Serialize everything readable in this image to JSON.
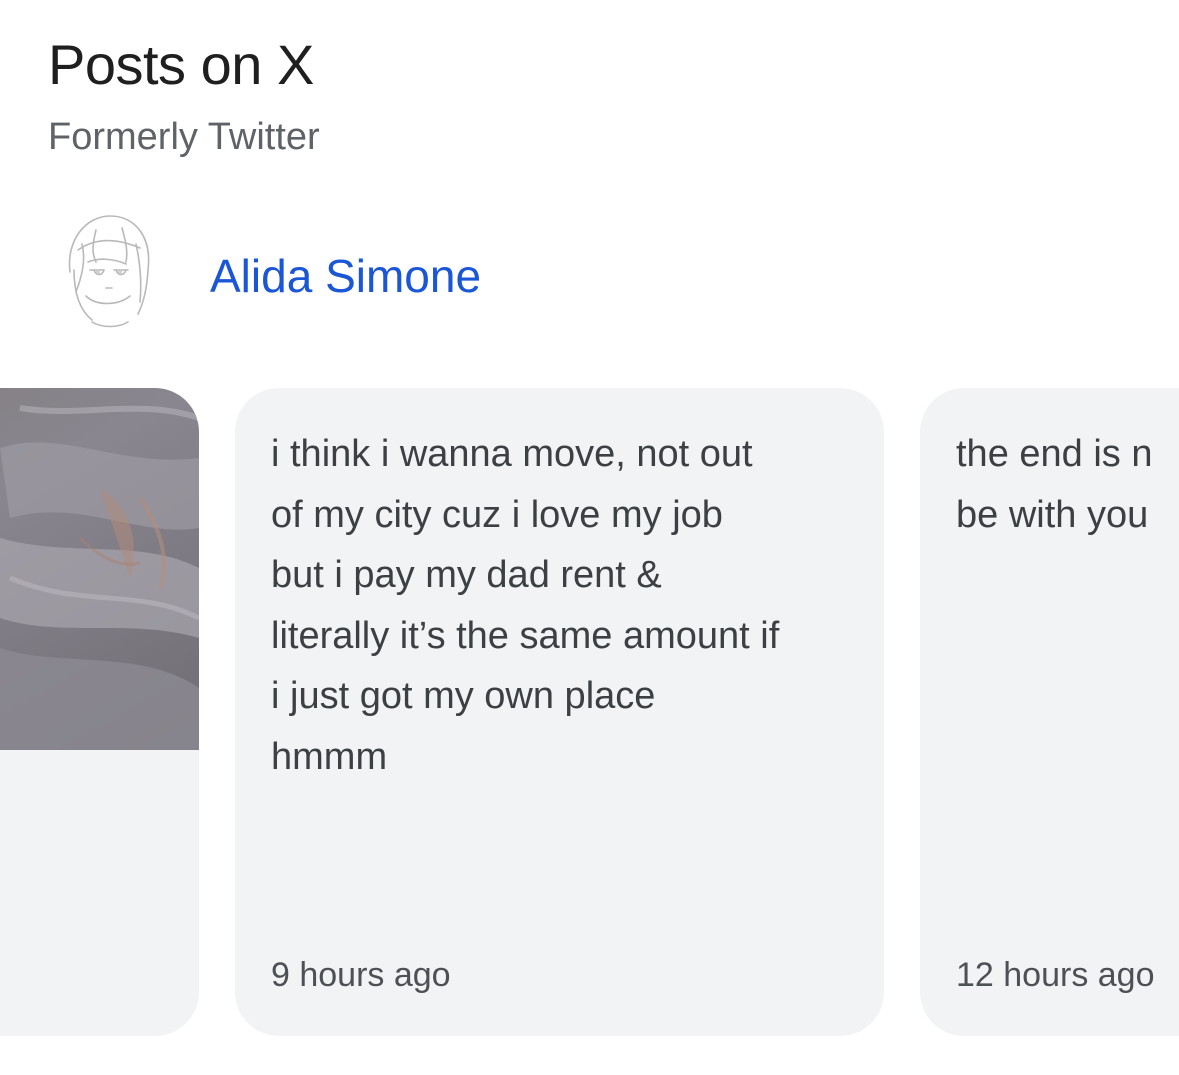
{
  "header": {
    "title": "Posts on X",
    "subtitle": "Formerly Twitter"
  },
  "author": {
    "name": "Alida Simone",
    "avatar_icon": "sketch-portrait-avatar"
  },
  "colors": {
    "link": "#1a56d6",
    "card_background": "#f2f3f5",
    "text": "#3c4043",
    "muted": "#5f6368"
  },
  "posts": [
    {
      "type": "image",
      "image_icon": "fabric-photo"
    },
    {
      "type": "text",
      "text": "i think i wanna move, not out\nof my city cuz i love my job\nbut i pay my dad rent &\nliterally it’s the same amount if\ni just got my own place\nhmmm",
      "time": "9 hours ago"
    },
    {
      "type": "text",
      "text": "the end is n\nbe with you",
      "time": "12 hours ago"
    }
  ]
}
